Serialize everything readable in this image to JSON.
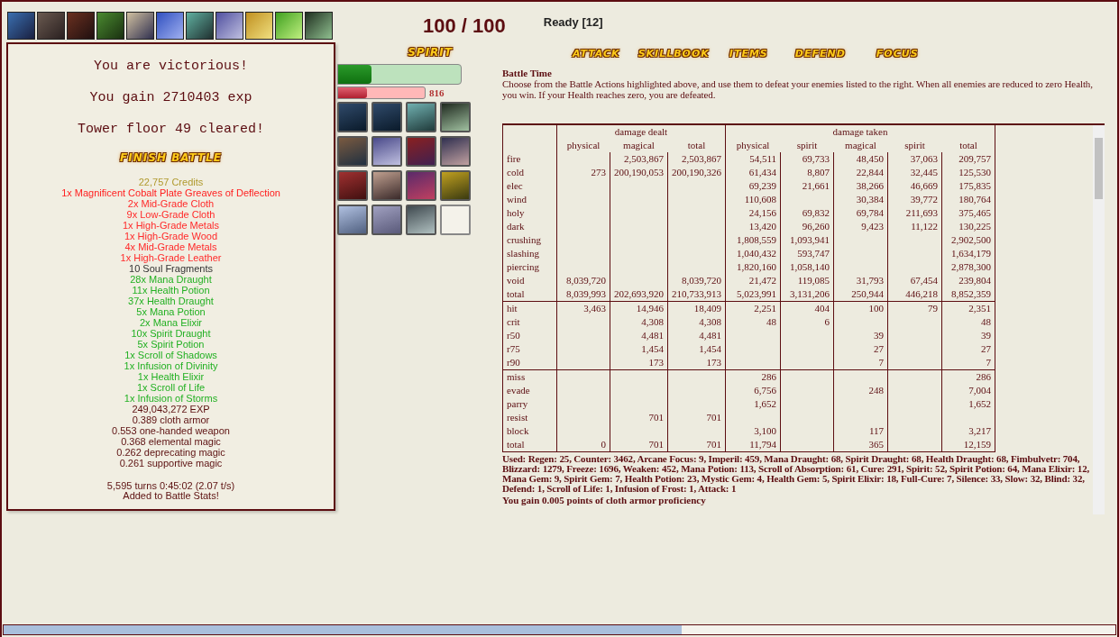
{
  "turn_counter": "100 / 100",
  "ready": "Ready [12]",
  "victory_popup": {
    "lines": [
      "You are victorious!",
      "You gain 2710403 exp",
      "Tower floor 49 cleared!"
    ],
    "finish_button": "FINISH BATTLE",
    "drops": [
      {
        "text": "22,757 Credits",
        "kind": "credits"
      },
      {
        "text": "1x Magnificent Cobalt Plate Greaves of Deflection",
        "kind": "equipment"
      },
      {
        "text": "2x Mid-Grade Cloth",
        "kind": "material"
      },
      {
        "text": "9x Low-Grade Cloth",
        "kind": "material"
      },
      {
        "text": "1x High-Grade Metals",
        "kind": "material"
      },
      {
        "text": "1x High-Grade Wood",
        "kind": "material"
      },
      {
        "text": "4x Mid-Grade Metals",
        "kind": "material"
      },
      {
        "text": "1x High-Grade Leather",
        "kind": "material"
      },
      {
        "text": "10 Soul Fragments",
        "kind": "token"
      },
      {
        "text": "28x Mana Draught",
        "kind": "consumable"
      },
      {
        "text": "11x Health Potion",
        "kind": "consumable"
      },
      {
        "text": "37x Health Draught",
        "kind": "consumable"
      },
      {
        "text": "5x Mana Potion",
        "kind": "consumable"
      },
      {
        "text": "2x Mana Elixir",
        "kind": "consumable"
      },
      {
        "text": "10x Spirit Draught",
        "kind": "consumable"
      },
      {
        "text": "5x Spirit Potion",
        "kind": "consumable"
      },
      {
        "text": "1x Scroll of Shadows",
        "kind": "consumable"
      },
      {
        "text": "1x Infusion of Divinity",
        "kind": "consumable"
      },
      {
        "text": "1x Health Elixir",
        "kind": "consumable"
      },
      {
        "text": "1x Scroll of Life",
        "kind": "consumable"
      },
      {
        "text": "1x Infusion of Storms",
        "kind": "consumable"
      },
      {
        "text": "249,043,272 EXP",
        "kind": "exp"
      },
      {
        "text": "0.389 cloth armor",
        "kind": "proficiency"
      },
      {
        "text": "0.553 one-handed weapon",
        "kind": "proficiency"
      },
      {
        "text": "0.368 elemental magic",
        "kind": "proficiency"
      },
      {
        "text": "0.262 deprecating magic",
        "kind": "proficiency"
      },
      {
        "text": "0.261 supportive magic",
        "kind": "proficiency"
      }
    ],
    "summary": [
      "5,595 turns 0:45:02 (2.07 t/s)",
      "Added to Battle Stats!"
    ]
  },
  "spirit_label": "SPIRIT",
  "spirit_bar": {
    "level": 0.27
  },
  "health_bar": {
    "level": 0.33,
    "reading": "816"
  },
  "actions": [
    "ATTACK",
    "SKILLBOOK",
    "ITEMS",
    "DEFEND",
    "FOCUS"
  ],
  "battle_time": {
    "title": "Battle Time",
    "text": "Choose from the Battle Actions highlighted above, and use them to defeat your enemies listed to the right. When all enemies are reduced to zero Health, you win. If your Health reaches zero, you are defeated."
  },
  "stats_table": {
    "groups": [
      "damage dealt",
      "damage taken"
    ],
    "columns": [
      "physical",
      "magical",
      "total",
      "physical",
      "spirit",
      "magical",
      "spirit",
      "total"
    ],
    "sections": [
      [
        {
          "label": "fire",
          "cells": [
            null,
            "2,503,867",
            "2,503,867",
            "54,511",
            "69,733",
            "48,450",
            "37,063",
            "209,757"
          ]
        },
        {
          "label": "cold",
          "cells": [
            "273",
            "200,190,053",
            "200,190,326",
            "61,434",
            "8,807",
            "22,844",
            "32,445",
            "125,530"
          ]
        },
        {
          "label": "elec",
          "cells": [
            null,
            null,
            null,
            "69,239",
            "21,661",
            "38,266",
            "46,669",
            "175,835"
          ]
        },
        {
          "label": "wind",
          "cells": [
            null,
            null,
            null,
            "110,608",
            null,
            "30,384",
            "39,772",
            "180,764"
          ]
        },
        {
          "label": "holy",
          "cells": [
            null,
            null,
            null,
            "24,156",
            "69,832",
            "69,784",
            "211,693",
            "375,465"
          ]
        },
        {
          "label": "dark",
          "cells": [
            null,
            null,
            null,
            "13,420",
            "96,260",
            "9,423",
            "11,122",
            "130,225"
          ]
        },
        {
          "label": "crushing",
          "cells": [
            null,
            null,
            null,
            "1,808,559",
            "1,093,941",
            null,
            null,
            "2,902,500"
          ]
        },
        {
          "label": "slashing",
          "cells": [
            null,
            null,
            null,
            "1,040,432",
            "593,747",
            null,
            null,
            "1,634,179"
          ]
        },
        {
          "label": "piercing",
          "cells": [
            null,
            null,
            null,
            "1,820,160",
            "1,058,140",
            null,
            null,
            "2,878,300"
          ]
        },
        {
          "label": "void",
          "cells": [
            "8,039,720",
            null,
            "8,039,720",
            "21,472",
            "119,085",
            "31,793",
            "67,454",
            "239,804"
          ]
        },
        {
          "label": "total",
          "cells": [
            "8,039,993",
            "202,693,920",
            "210,733,913",
            "5,023,991",
            "3,131,206",
            "250,944",
            "446,218",
            "8,852,359"
          ]
        }
      ],
      [
        {
          "label": "hit",
          "cells": [
            "3,463",
            "14,946",
            "18,409",
            "2,251",
            "404",
            "100",
            "79",
            "2,351"
          ]
        },
        {
          "label": "crit",
          "cells": [
            null,
            "4,308",
            "4,308",
            "48",
            "6",
            null,
            null,
            "48"
          ]
        },
        {
          "label": "r50",
          "cells": [
            null,
            "4,481",
            "4,481",
            null,
            null,
            "39",
            null,
            "39"
          ]
        },
        {
          "label": "r75",
          "cells": [
            null,
            "1,454",
            "1,454",
            null,
            null,
            "27",
            null,
            "27"
          ]
        },
        {
          "label": "r90",
          "cells": [
            null,
            "173",
            "173",
            null,
            null,
            "7",
            null,
            "7"
          ]
        }
      ],
      [
        {
          "label": "miss",
          "cells": [
            null,
            null,
            null,
            "286",
            null,
            null,
            null,
            "286"
          ]
        },
        {
          "label": "evade",
          "cells": [
            null,
            null,
            null,
            "6,756",
            null,
            "248",
            null,
            "7,004"
          ]
        },
        {
          "label": "parry",
          "cells": [
            null,
            null,
            null,
            "1,652",
            null,
            null,
            null,
            "1,652"
          ]
        },
        {
          "label": "resist",
          "cells": [
            null,
            "701",
            "701",
            null,
            null,
            null,
            null,
            null
          ]
        },
        {
          "label": "block",
          "cells": [
            null,
            null,
            null,
            "3,100",
            null,
            "117",
            null,
            "3,217"
          ]
        },
        {
          "label": "total",
          "cells": [
            "0",
            "701",
            "701",
            "11,794",
            null,
            "365",
            null,
            "12,159"
          ]
        }
      ]
    ]
  },
  "used_text": "Used: Regen: 25, Counter: 3462, Arcane Focus: 9, Imperil: 459, Mana Draught: 68, Spirit Draught: 68, Health Draught: 68, Fimbulvetr: 704, Blizzard: 1279, Freeze: 1696, Weaken: 452, Mana Potion: 113, Scroll of Absorption: 61, Cure: 291, Spirit: 52, Spirit Potion: 64, Mana Elixir: 12, Mana Gem: 9, Spirit Gem: 7, Health Potion: 23, Mystic Gem: 4, Health Gem: 5, Spirit Elixir: 18, Full-Cure: 7, Silence: 33, Slow: 32, Blind: 32, Defend: 1, Scroll of Life: 1, Infusion of Frost: 1, Attack: 1",
  "proficiency_text": "You gain 0.005 points of cloth armor proficiency",
  "progress": {
    "level": 0.61
  }
}
